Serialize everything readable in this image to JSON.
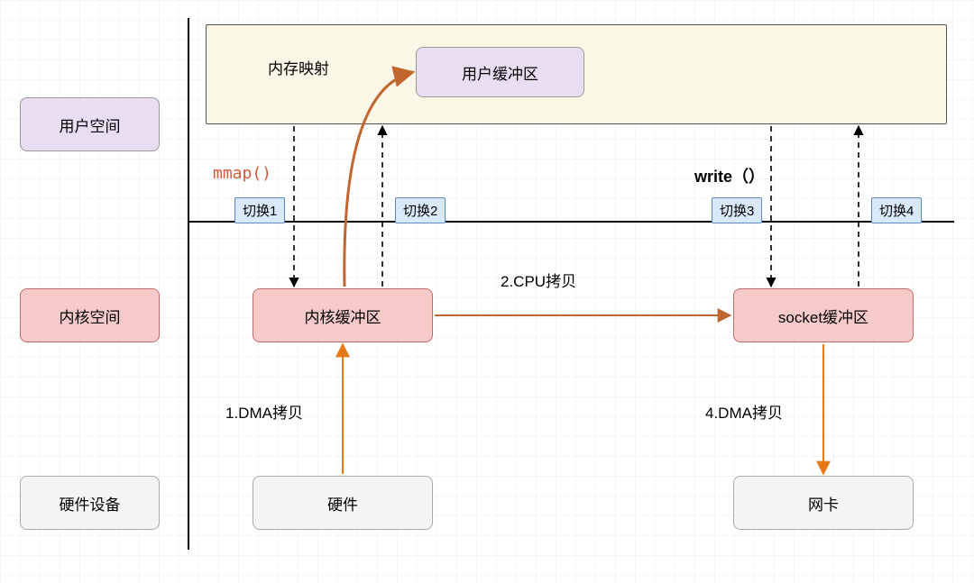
{
  "left_labels": {
    "user_space": "用户空间",
    "kernel_space": "内核空间",
    "hardware": "硬件设备"
  },
  "boxes": {
    "user_buffer": "用户缓冲区",
    "kernel_buffer": "内核缓冲区",
    "socket_buffer": "socket缓冲区",
    "hardware_block": "硬件",
    "nic": "网卡"
  },
  "switch_labels": {
    "s1": "切换1",
    "s2": "切换2",
    "s3": "切换3",
    "s4": "切换4"
  },
  "syscalls": {
    "mmap": "mmap()",
    "write": "write（）"
  },
  "annotations": {
    "mem_map": "内存映射",
    "dma1": "1.DMA拷贝",
    "cpu_copy": "2.CPU拷贝",
    "dma4": "4.DMA拷贝"
  }
}
